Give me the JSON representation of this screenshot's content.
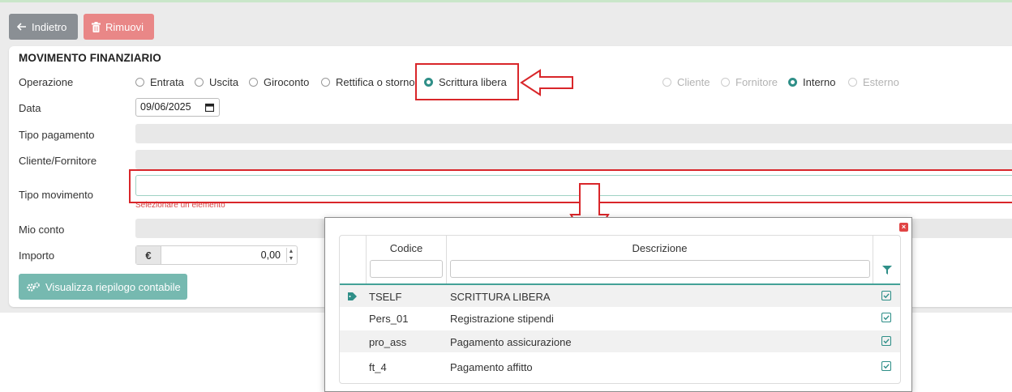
{
  "toolbar": {
    "back_label": "Indietro",
    "remove_label": "Rimuovi"
  },
  "form": {
    "title": "MOVIMENTO FINANZIARIO",
    "operazione_label": "Operazione",
    "operazione_options": [
      "Entrata",
      "Uscita",
      "Giroconto",
      "Rettifica o storno",
      "Scrittura libera"
    ],
    "operazione_selected": "Scrittura libera",
    "controparte_options": [
      "Cliente",
      "Fornitore",
      "Interno",
      "Esterno"
    ],
    "controparte_selected": "Interno",
    "data_label": "Data",
    "data_value": "09/06/2025",
    "tipo_pagamento_label": "Tipo pagamento",
    "cliente_fornitore_label": "Cliente/Fornitore",
    "tipo_movimento_label": "Tipo movimento",
    "tipo_movimento_error": "Selezionare un elemento",
    "mio_conto_label": "Mio conto",
    "importo_label": "Importo",
    "currency_symbol": "€",
    "importo_value": "0,00",
    "riepilogo_label": "Visualizza riepilogo contabile"
  },
  "dropdown": {
    "col_codice": "Codice",
    "col_descrizione": "Descrizione",
    "rows": [
      {
        "codice": "TSELF",
        "descrizione": "SCRITTURA LIBERA"
      },
      {
        "codice": "Pers_01",
        "descrizione": "Registrazione stipendi"
      },
      {
        "codice": "pro_ass",
        "descrizione": "Pagamento assicurazione"
      },
      {
        "codice": "ft_4",
        "descrizione": "Pagamento affitto"
      }
    ]
  },
  "colors": {
    "accent": "#2f8f88",
    "highlight": "#d9262a",
    "error": "#d64545"
  }
}
